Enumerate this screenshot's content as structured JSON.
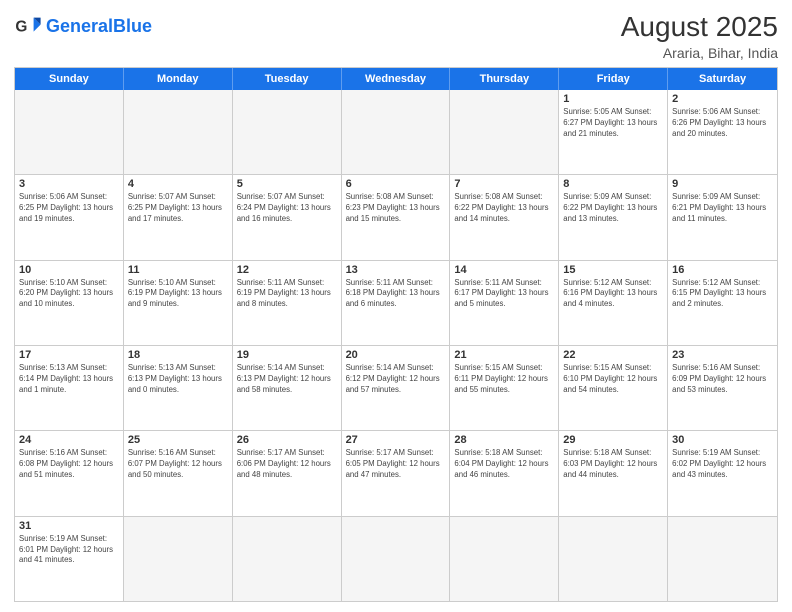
{
  "header": {
    "logo_general": "General",
    "logo_blue": "Blue",
    "main_title": "August 2025",
    "sub_title": "Araria, Bihar, India"
  },
  "calendar": {
    "days_of_week": [
      "Sunday",
      "Monday",
      "Tuesday",
      "Wednesday",
      "Thursday",
      "Friday",
      "Saturday"
    ],
    "weeks": [
      [
        {
          "day": "",
          "info": ""
        },
        {
          "day": "",
          "info": ""
        },
        {
          "day": "",
          "info": ""
        },
        {
          "day": "",
          "info": ""
        },
        {
          "day": "",
          "info": ""
        },
        {
          "day": "1",
          "info": "Sunrise: 5:05 AM\nSunset: 6:27 PM\nDaylight: 13 hours\nand 21 minutes."
        },
        {
          "day": "2",
          "info": "Sunrise: 5:06 AM\nSunset: 6:26 PM\nDaylight: 13 hours\nand 20 minutes."
        }
      ],
      [
        {
          "day": "3",
          "info": "Sunrise: 5:06 AM\nSunset: 6:25 PM\nDaylight: 13 hours\nand 19 minutes."
        },
        {
          "day": "4",
          "info": "Sunrise: 5:07 AM\nSunset: 6:25 PM\nDaylight: 13 hours\nand 17 minutes."
        },
        {
          "day": "5",
          "info": "Sunrise: 5:07 AM\nSunset: 6:24 PM\nDaylight: 13 hours\nand 16 minutes."
        },
        {
          "day": "6",
          "info": "Sunrise: 5:08 AM\nSunset: 6:23 PM\nDaylight: 13 hours\nand 15 minutes."
        },
        {
          "day": "7",
          "info": "Sunrise: 5:08 AM\nSunset: 6:22 PM\nDaylight: 13 hours\nand 14 minutes."
        },
        {
          "day": "8",
          "info": "Sunrise: 5:09 AM\nSunset: 6:22 PM\nDaylight: 13 hours\nand 13 minutes."
        },
        {
          "day": "9",
          "info": "Sunrise: 5:09 AM\nSunset: 6:21 PM\nDaylight: 13 hours\nand 11 minutes."
        }
      ],
      [
        {
          "day": "10",
          "info": "Sunrise: 5:10 AM\nSunset: 6:20 PM\nDaylight: 13 hours\nand 10 minutes."
        },
        {
          "day": "11",
          "info": "Sunrise: 5:10 AM\nSunset: 6:19 PM\nDaylight: 13 hours\nand 9 minutes."
        },
        {
          "day": "12",
          "info": "Sunrise: 5:11 AM\nSunset: 6:19 PM\nDaylight: 13 hours\nand 8 minutes."
        },
        {
          "day": "13",
          "info": "Sunrise: 5:11 AM\nSunset: 6:18 PM\nDaylight: 13 hours\nand 6 minutes."
        },
        {
          "day": "14",
          "info": "Sunrise: 5:11 AM\nSunset: 6:17 PM\nDaylight: 13 hours\nand 5 minutes."
        },
        {
          "day": "15",
          "info": "Sunrise: 5:12 AM\nSunset: 6:16 PM\nDaylight: 13 hours\nand 4 minutes."
        },
        {
          "day": "16",
          "info": "Sunrise: 5:12 AM\nSunset: 6:15 PM\nDaylight: 13 hours\nand 2 minutes."
        }
      ],
      [
        {
          "day": "17",
          "info": "Sunrise: 5:13 AM\nSunset: 6:14 PM\nDaylight: 13 hours\nand 1 minute."
        },
        {
          "day": "18",
          "info": "Sunrise: 5:13 AM\nSunset: 6:13 PM\nDaylight: 13 hours\nand 0 minutes."
        },
        {
          "day": "19",
          "info": "Sunrise: 5:14 AM\nSunset: 6:13 PM\nDaylight: 12 hours\nand 58 minutes."
        },
        {
          "day": "20",
          "info": "Sunrise: 5:14 AM\nSunset: 6:12 PM\nDaylight: 12 hours\nand 57 minutes."
        },
        {
          "day": "21",
          "info": "Sunrise: 5:15 AM\nSunset: 6:11 PM\nDaylight: 12 hours\nand 55 minutes."
        },
        {
          "day": "22",
          "info": "Sunrise: 5:15 AM\nSunset: 6:10 PM\nDaylight: 12 hours\nand 54 minutes."
        },
        {
          "day": "23",
          "info": "Sunrise: 5:16 AM\nSunset: 6:09 PM\nDaylight: 12 hours\nand 53 minutes."
        }
      ],
      [
        {
          "day": "24",
          "info": "Sunrise: 5:16 AM\nSunset: 6:08 PM\nDaylight: 12 hours\nand 51 minutes."
        },
        {
          "day": "25",
          "info": "Sunrise: 5:16 AM\nSunset: 6:07 PM\nDaylight: 12 hours\nand 50 minutes."
        },
        {
          "day": "26",
          "info": "Sunrise: 5:17 AM\nSunset: 6:06 PM\nDaylight: 12 hours\nand 48 minutes."
        },
        {
          "day": "27",
          "info": "Sunrise: 5:17 AM\nSunset: 6:05 PM\nDaylight: 12 hours\nand 47 minutes."
        },
        {
          "day": "28",
          "info": "Sunrise: 5:18 AM\nSunset: 6:04 PM\nDaylight: 12 hours\nand 46 minutes."
        },
        {
          "day": "29",
          "info": "Sunrise: 5:18 AM\nSunset: 6:03 PM\nDaylight: 12 hours\nand 44 minutes."
        },
        {
          "day": "30",
          "info": "Sunrise: 5:19 AM\nSunset: 6:02 PM\nDaylight: 12 hours\nand 43 minutes."
        }
      ],
      [
        {
          "day": "31",
          "info": "Sunrise: 5:19 AM\nSunset: 6:01 PM\nDaylight: 12 hours\nand 41 minutes."
        },
        {
          "day": "",
          "info": ""
        },
        {
          "day": "",
          "info": ""
        },
        {
          "day": "",
          "info": ""
        },
        {
          "day": "",
          "info": ""
        },
        {
          "day": "",
          "info": ""
        },
        {
          "day": "",
          "info": ""
        }
      ]
    ]
  }
}
